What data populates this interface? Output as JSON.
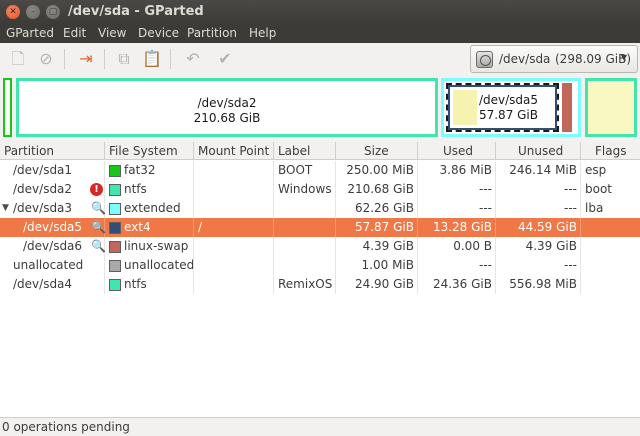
{
  "window": {
    "title": "/dev/sda - GParted",
    "close_glyph": "✕",
    "minimize_glyph": "–",
    "maximize_glyph": "▢"
  },
  "menu": [
    "GParted",
    "Edit",
    "View",
    "Device",
    "Partition",
    "Help"
  ],
  "toolbar": {
    "new_glyph": "🗋",
    "delete_glyph": "⊘",
    "resize_glyph": "⇥",
    "copy_glyph": "⧉",
    "paste_glyph": "📋",
    "undo_glyph": "↶",
    "apply_glyph": "✔"
  },
  "device": {
    "name": "/dev/sda",
    "size": "(298.09 GiB)",
    "arrow": "▾"
  },
  "diskmap": {
    "sda2": {
      "name": "/dev/sda2",
      "size": "210.68 GiB"
    },
    "sda5": {
      "name": "/dev/sda5",
      "size": "57.87 GiB"
    }
  },
  "columns": [
    "Partition",
    "File System",
    "Mount Point",
    "Label",
    "Size",
    "Used",
    "Unused",
    "Flags"
  ],
  "rows": [
    {
      "partition": "/dev/sda1",
      "fs": "fat32",
      "mount": "",
      "label": "BOOT",
      "size": "250.00 MiB",
      "used": "3.86 MiB",
      "unused": "246.14 MiB",
      "flags": "esp"
    },
    {
      "partition": "/dev/sda2",
      "fs": "ntfs",
      "mount": "",
      "label": "Windows",
      "size": "210.68 GiB",
      "used": "---",
      "unused": "---",
      "flags": "boot"
    },
    {
      "partition": "/dev/sda3",
      "fs": "extended",
      "mount": "",
      "label": "",
      "size": "62.26 GiB",
      "used": "---",
      "unused": "---",
      "flags": "lba"
    },
    {
      "partition": "/dev/sda5",
      "fs": "ext4",
      "mount": "/",
      "label": "",
      "size": "57.87 GiB",
      "used": "13.28 GiB",
      "unused": "44.59 GiB",
      "flags": ""
    },
    {
      "partition": "/dev/sda6",
      "fs": "linux-swap",
      "mount": "",
      "label": "",
      "size": "4.39 GiB",
      "used": "0.00 B",
      "unused": "4.39 GiB",
      "flags": ""
    },
    {
      "partition": "unallocated",
      "fs": "unallocated",
      "mount": "",
      "label": "",
      "size": "1.00 MiB",
      "used": "---",
      "unused": "---",
      "flags": ""
    },
    {
      "partition": "/dev/sda4",
      "fs": "ntfs",
      "mount": "",
      "label": "RemixOS",
      "size": "24.90 GiB",
      "used": "24.36 GiB",
      "unused": "556.98 MiB",
      "flags": ""
    }
  ],
  "row_icons": {
    "warning_glyph": "!",
    "key_glyph": "🔍",
    "expander_glyph": "▼"
  },
  "colors": {
    "fat32": "#18c818",
    "ntfs": "#42e5ac",
    "extended": "#7dfcfe",
    "ext4": "#314e78",
    "linux-swap": "#c1665a",
    "unallocated": "#a9a9a9",
    "selection": "#f07746"
  },
  "status": "0 operations pending"
}
